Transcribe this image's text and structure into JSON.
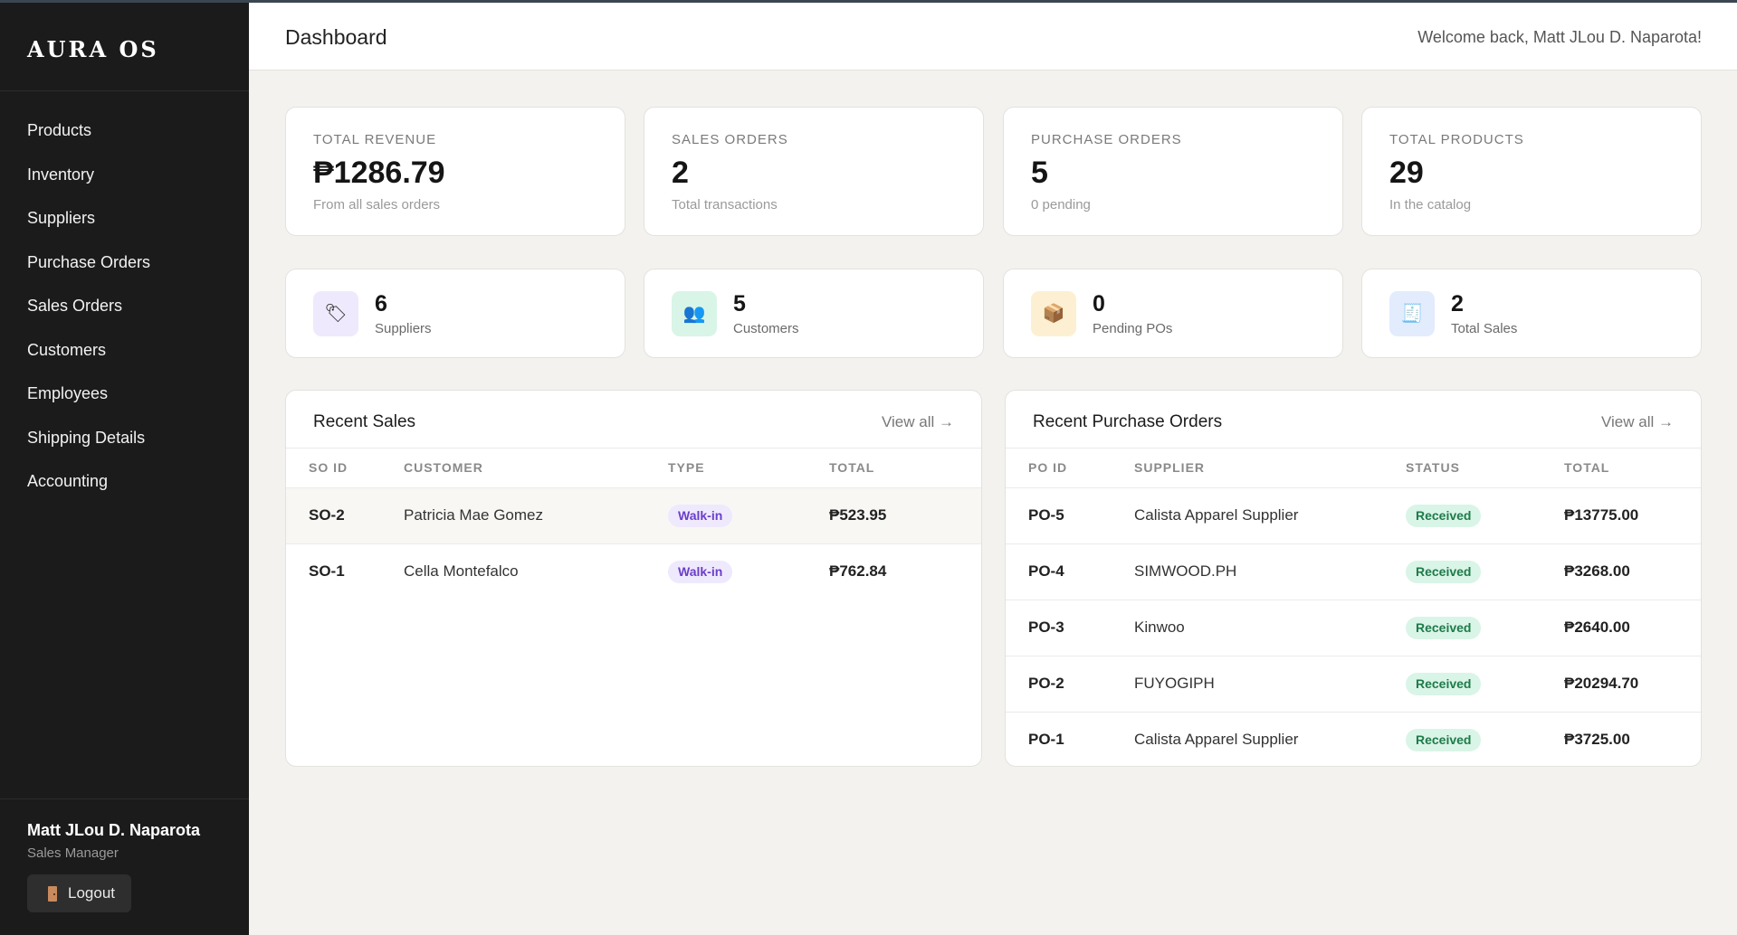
{
  "app": {
    "brand": "AURA OS"
  },
  "sidebar": {
    "items": [
      {
        "label": "Products"
      },
      {
        "label": "Inventory"
      },
      {
        "label": "Suppliers"
      },
      {
        "label": "Purchase Orders"
      },
      {
        "label": "Sales Orders"
      },
      {
        "label": "Customers"
      },
      {
        "label": "Employees"
      },
      {
        "label": "Shipping Details"
      },
      {
        "label": "Accounting"
      }
    ],
    "user": {
      "name": "Matt JLou D. Naparota",
      "role": "Sales Manager"
    },
    "logout_label": "Logout"
  },
  "header": {
    "title": "Dashboard",
    "welcome": "Welcome back, Matt JLou D. Naparota!"
  },
  "stats": [
    {
      "label": "TOTAL REVENUE",
      "value": "₱1286.79",
      "sub": "From all sales orders"
    },
    {
      "label": "SALES ORDERS",
      "value": "2",
      "sub": "Total transactions"
    },
    {
      "label": "PURCHASE ORDERS",
      "value": "5",
      "sub": "0 pending"
    },
    {
      "label": "TOTAL PRODUCTS",
      "value": "29",
      "sub": "In the catalog"
    }
  ],
  "mini_stats": [
    {
      "value": "6",
      "label": "Suppliers",
      "icon": "tag-icon",
      "icon_glyph": "🏷",
      "bg": "#efe9fd"
    },
    {
      "value": "5",
      "label": "Customers",
      "icon": "users-icon",
      "icon_glyph": "👥",
      "bg": "#d9f5e7"
    },
    {
      "value": "0",
      "label": "Pending POs",
      "icon": "package-icon",
      "icon_glyph": "📦",
      "bg": "#fdf0d2"
    },
    {
      "value": "2",
      "label": "Total Sales",
      "icon": "receipt-icon",
      "icon_glyph": "🧾",
      "bg": "#e3ecfd"
    }
  ],
  "recent_sales": {
    "title": "Recent Sales",
    "view_all": "View all →",
    "columns": [
      "SO ID",
      "CUSTOMER",
      "TYPE",
      "TOTAL"
    ],
    "rows": [
      {
        "id": "SO-2",
        "customer": "Patricia Mae Gomez",
        "type": "Walk-in",
        "total": "₱523.95"
      },
      {
        "id": "SO-1",
        "customer": "Cella Montefalco",
        "type": "Walk-in",
        "total": "₱762.84"
      }
    ]
  },
  "recent_pos": {
    "title": "Recent Purchase Orders",
    "view_all": "View all →",
    "columns": [
      "PO ID",
      "SUPPLIER",
      "STATUS",
      "TOTAL"
    ],
    "rows": [
      {
        "id": "PO-5",
        "supplier": "Calista Apparel Supplier",
        "status": "Received",
        "total": "₱13775.00"
      },
      {
        "id": "PO-4",
        "supplier": "SIMWOOD.PH",
        "status": "Received",
        "total": "₱3268.00"
      },
      {
        "id": "PO-3",
        "supplier": "Kinwoo",
        "status": "Received",
        "total": "₱2640.00"
      },
      {
        "id": "PO-2",
        "supplier": "FUYOGIPH",
        "status": "Received",
        "total": "₱20294.70"
      },
      {
        "id": "PO-1",
        "supplier": "Calista Apparel Supplier",
        "status": "Received",
        "total": "₱3725.00"
      }
    ]
  },
  "colors": {
    "sidebar_bg": "#1b1b1b",
    "page_bg": "#f3f2ef",
    "badge_purple": "#6a3fc8",
    "badge_green": "#1f7a4a"
  }
}
